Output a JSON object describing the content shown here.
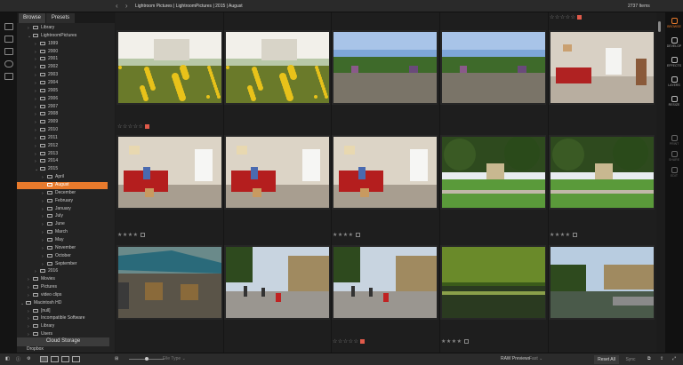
{
  "header": {
    "nav_back": "‹",
    "nav_forward": "›",
    "path": "Lightroom Pictures | LightroomPictures | 2015 | August",
    "item_count": "2737 Items"
  },
  "panel": {
    "tabs": [
      "Browse",
      "Presets"
    ],
    "tree": [
      {
        "label": "Library",
        "indent": 1,
        "arrow": "›"
      },
      {
        "label": "LightroomPictures",
        "indent": 1,
        "arrow": "⌄"
      },
      {
        "label": "1999",
        "indent": 2,
        "arrow": "›"
      },
      {
        "label": "2000",
        "indent": 2,
        "arrow": "›"
      },
      {
        "label": "2001",
        "indent": 2,
        "arrow": "›"
      },
      {
        "label": "2002",
        "indent": 2,
        "arrow": "›"
      },
      {
        "label": "2003",
        "indent": 2,
        "arrow": "›"
      },
      {
        "label": "2004",
        "indent": 2,
        "arrow": "›"
      },
      {
        "label": "2005",
        "indent": 2,
        "arrow": "›"
      },
      {
        "label": "2006",
        "indent": 2,
        "arrow": "›"
      },
      {
        "label": "2007",
        "indent": 2,
        "arrow": "›"
      },
      {
        "label": "2008",
        "indent": 2,
        "arrow": "›"
      },
      {
        "label": "2009",
        "indent": 2,
        "arrow": "›"
      },
      {
        "label": "2010",
        "indent": 2,
        "arrow": "›"
      },
      {
        "label": "2011",
        "indent": 2,
        "arrow": "›"
      },
      {
        "label": "2012",
        "indent": 2,
        "arrow": "›"
      },
      {
        "label": "2013",
        "indent": 2,
        "arrow": "›"
      },
      {
        "label": "2014",
        "indent": 2,
        "arrow": "›"
      },
      {
        "label": "2015",
        "indent": 2,
        "arrow": "⌄"
      },
      {
        "label": "April",
        "indent": 3,
        "arrow": "›"
      },
      {
        "label": "August",
        "indent": 3,
        "arrow": "›",
        "selected": true
      },
      {
        "label": "December",
        "indent": 3,
        "arrow": "›"
      },
      {
        "label": "February",
        "indent": 3,
        "arrow": "›"
      },
      {
        "label": "January",
        "indent": 3,
        "arrow": "›"
      },
      {
        "label": "July",
        "indent": 3,
        "arrow": "›"
      },
      {
        "label": "June",
        "indent": 3,
        "arrow": "›"
      },
      {
        "label": "March",
        "indent": 3,
        "arrow": "›"
      },
      {
        "label": "May",
        "indent": 3,
        "arrow": "›"
      },
      {
        "label": "November",
        "indent": 3,
        "arrow": "›"
      },
      {
        "label": "October",
        "indent": 3,
        "arrow": "›"
      },
      {
        "label": "September",
        "indent": 3,
        "arrow": "›"
      },
      {
        "label": "2016",
        "indent": 2,
        "arrow": "›"
      },
      {
        "label": "Movies",
        "indent": 1,
        "arrow": "›"
      },
      {
        "label": "Pictures",
        "indent": 1,
        "arrow": "›"
      },
      {
        "label": "video clips",
        "indent": 1,
        "arrow": "›"
      },
      {
        "label": "Macintosh HD",
        "indent": 0,
        "arrow": "⌄",
        "drive": true
      },
      {
        "label": "[null]",
        "indent": 1,
        "arrow": "›"
      },
      {
        "label": "Incompatible Software",
        "indent": 1,
        "arrow": "›"
      },
      {
        "label": "Library",
        "indent": 1,
        "arrow": "›"
      },
      {
        "label": "Users",
        "indent": 1,
        "arrow": "›"
      },
      {
        "label": "RICOHDCX",
        "indent": 0,
        "arrow": "›",
        "drive": true
      }
    ],
    "cloud_storage": "Cloud Storage",
    "dropbox": "Dropbox"
  },
  "grid": {
    "rows": [
      {
        "photos": [
          {
            "scene": "flowers-bright"
          },
          {
            "scene": "flowers-bright"
          },
          {
            "scene": "garden-path"
          },
          {
            "scene": "garden-path"
          },
          {
            "scene": "room-window",
            "rating_top": "☆☆☆☆☆",
            "flag_top": "red"
          }
        ]
      },
      {
        "rating_label": "☆☆☆☆☆",
        "photos": [
          {
            "scene": "room-red-sofa"
          },
          {
            "scene": "room-red-sofa"
          },
          {
            "scene": "room-red-sofa"
          },
          {
            "scene": "village-green"
          },
          {
            "scene": "village-green"
          }
        ]
      },
      {
        "photos": [
          {
            "scene": "cafe-umbrellas"
          },
          {
            "scene": "street-shops"
          },
          {
            "scene": "street-shops"
          },
          {
            "scene": "river-willow"
          },
          {
            "scene": "river-village"
          }
        ]
      }
    ],
    "row1_label": "☆☆☆☆☆",
    "row2_labels": [
      "★★★★",
      "",
      "★★★★",
      "",
      "★★★★"
    ],
    "row3_labels": [
      "",
      "",
      "☆☆☆☆☆",
      "★★★★",
      ""
    ]
  },
  "modules": [
    {
      "label": "BROWSE",
      "state": "active"
    },
    {
      "label": "DEVELOP",
      "state": "normal"
    },
    {
      "label": "EFFECTS",
      "state": "normal"
    },
    {
      "label": "LAYERS",
      "state": "normal"
    },
    {
      "label": "RESIZE",
      "state": "normal"
    },
    {
      "label": "PRINT",
      "state": "dim"
    },
    {
      "label": "SHARE",
      "state": "dim"
    },
    {
      "label": "EDIT",
      "state": "dim"
    }
  ],
  "footer": {
    "filter_label": "File Type",
    "raw_label": "RAW Previews",
    "raw_value": "Fast",
    "reset_all": "Reset All",
    "sync": "Sync"
  },
  "colors": {
    "accent": "#e87a2c",
    "flag_red": "#e05a4a"
  }
}
